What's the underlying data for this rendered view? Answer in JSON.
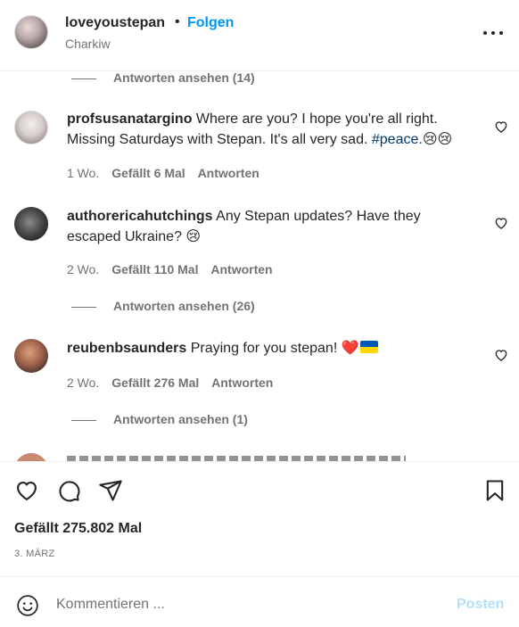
{
  "header": {
    "username": "loveyoustepan",
    "separator": "•",
    "follow_label": "Folgen",
    "location": "Charkiw",
    "more_icon": "more-options-icon"
  },
  "comments": {
    "top_view_replies": "Antworten ansehen (14)",
    "items": [
      {
        "username": "profsusanatargino",
        "text": "Where are you? I hope you're all right. Missing Saturdays with Stepan. It's all very sad. ",
        "hashtag": "#peace.",
        "emoji": "😢😢",
        "time": "1 Wo.",
        "likes": "Gefällt 6 Mal",
        "reply": "Antworten",
        "view_replies": ""
      },
      {
        "username": "authorericahutchings",
        "text": "Any Stepan updates? Have they escaped Ukraine? ",
        "emoji": "😢",
        "time": "2 Wo.",
        "likes": "Gefällt 110 Mal",
        "reply": "Antworten",
        "view_replies": "Antworten ansehen (26)"
      },
      {
        "username": "reubenbsaunders",
        "text": "Praying for you stepan! ",
        "emoji": "❤️",
        "flag_colors": [
          "#0057b7",
          "#ffd700"
        ],
        "time": "2 Wo.",
        "likes": "Gefällt 276 Mal",
        "reply": "Antworten",
        "view_replies": "Antworten ansehen (1)"
      }
    ]
  },
  "actions": {
    "like_icon": "heart-icon",
    "comment_icon": "comment-icon",
    "share_icon": "share-icon",
    "save_icon": "bookmark-icon",
    "likes_text": "Gefällt 275.802 Mal",
    "date": "3. MÄRZ"
  },
  "comment_box": {
    "placeholder": "Kommentieren ...",
    "post_label": "Posten",
    "emoji_icon": "smiley-icon"
  },
  "colors": {
    "link_blue": "#0095f6",
    "post_disabled": "#b2dffc",
    "hashtag": "#00376b",
    "secondary_text": "#737373",
    "flag_blue": "#0057b7",
    "flag_yellow": "#ffd700"
  }
}
